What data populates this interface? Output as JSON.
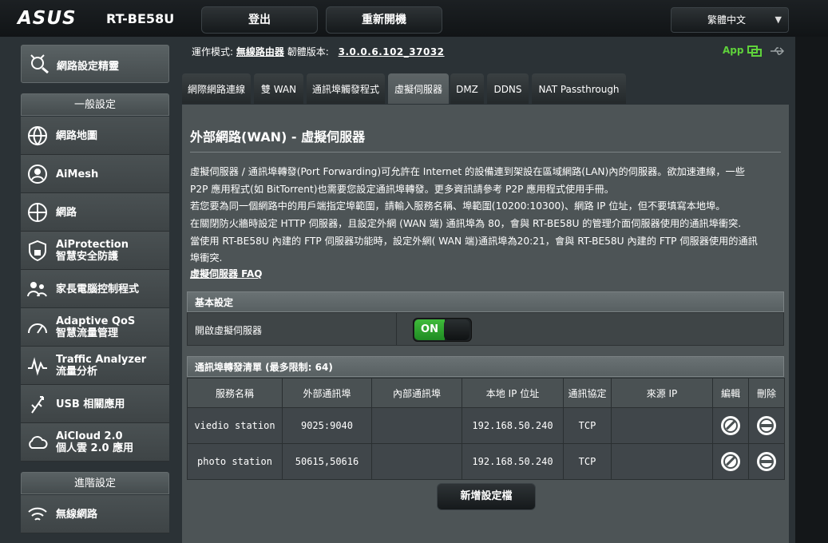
{
  "header": {
    "logo": "ASUS",
    "model": "RT-BE58U",
    "logout": "登出",
    "reboot": "重新開機",
    "language": "繁體中文"
  },
  "status": {
    "mode_label": "運作模式:",
    "mode_value": "無線路由器",
    "fw_label": "韌體版本:",
    "fw_value": "3.0.0.6.102_37032",
    "app_label": "App"
  },
  "sidebar": {
    "qis": "網路設定精靈",
    "general_head": "一般設定",
    "general_items": [
      {
        "line1": "網路地圖",
        "line2": ""
      },
      {
        "line1": "AiMesh",
        "line2": ""
      },
      {
        "line1": "網路",
        "line2": ""
      },
      {
        "line1": "AiProtection",
        "line2": "智慧安全防護"
      },
      {
        "line1": "家長電腦控制程式",
        "line2": ""
      },
      {
        "line1": "Adaptive QoS",
        "line2": "智慧流量管理"
      },
      {
        "line1": "Traffic Analyzer",
        "line2": "流量分析"
      },
      {
        "line1": "USB 相關應用",
        "line2": ""
      },
      {
        "line1": "AiCloud 2.0",
        "line2": "個人雲 2.0 應用"
      }
    ],
    "advanced_head": "進階設定",
    "advanced_items": [
      {
        "line1": "無線網路",
        "line2": ""
      }
    ]
  },
  "tabs": [
    {
      "label": "網際網路連線",
      "active": false
    },
    {
      "label": "雙 WAN",
      "active": false
    },
    {
      "label": "通訊埠觸發程式",
      "active": false
    },
    {
      "label": "虛擬伺服器",
      "active": true
    },
    {
      "label": "DMZ",
      "active": false
    },
    {
      "label": "DDNS",
      "active": false
    },
    {
      "label": "NAT Passthrough",
      "active": false
    }
  ],
  "main": {
    "title": "外部網路(WAN) - 虛擬伺服器",
    "desc": [
      "虛擬伺服器 / 通訊埠轉發(Port Forwarding)可允許在 Internet 的設備連到架設在區域網路(LAN)內的伺服器。欲加速連線，一些",
      "P2P 應用程式(如 BitTorrent)也需要您設定通訊埠轉發。更多資訊請參考 P2P 應用程式使用手冊。",
      "若您要為同一個網路中的用戶端指定埠範圍，請輸入服務名稱、埠範圍(10200:10300)、網路 IP 位址，但不要填寫本地埠。",
      "在關閉防火牆時設定 HTTP 伺服器，且設定外網 (WAN 端) 通訊埠為 80，會與 RT-BE58U 的管理介面伺服器使用的通訊埠衝突.",
      "當使用 RT-BE58U 內建的 FTP 伺服器功能時，設定外網( WAN 端)通訊埠為20:21，會與 RT-BE58U 內建的 FTP 伺服器使用的通訊",
      "埠衝突."
    ],
    "faq": "虛擬伺服器  FAQ",
    "basic_head": "基本設定",
    "enable_label": "開啟虛擬伺服器",
    "toggle_on": "ON",
    "list_head": "通訊埠轉發清單 (最多限制: 64)",
    "columns": [
      "服務名稱",
      "外部通訊埠",
      "內部通訊埠",
      "本地 IP 位址",
      "通訊協定",
      "來源 IP",
      "編輯",
      "刪除"
    ],
    "rows": [
      {
        "name": "viedio station",
        "ext": "9025:9040",
        "int": "",
        "ip": "192.168.50.240",
        "proto": "TCP",
        "src": ""
      },
      {
        "name": "photo station",
        "ext": "50615,50616",
        "int": "",
        "ip": "192.168.50.240",
        "proto": "TCP",
        "src": ""
      }
    ],
    "add_button": "新增設定檔"
  }
}
